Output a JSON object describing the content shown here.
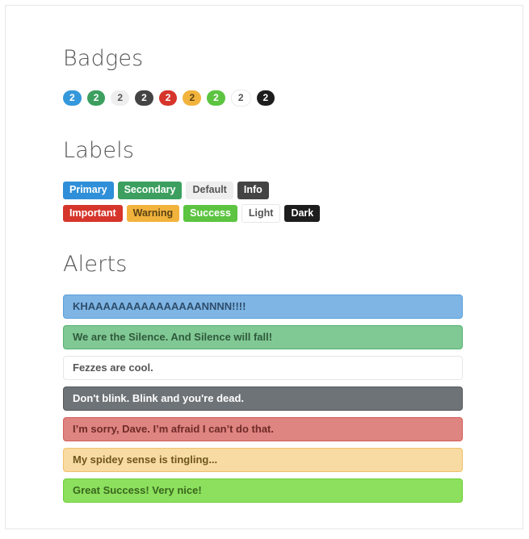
{
  "sections": {
    "badges": {
      "heading": "Badges",
      "items": [
        {
          "name": "primary",
          "text": "2",
          "color": "#3498db"
        },
        {
          "name": "secondary",
          "text": "2",
          "color": "#3c9f5f"
        },
        {
          "name": "default",
          "text": "2",
          "color": "#eeeeee"
        },
        {
          "name": "info",
          "text": "2",
          "color": "#444444"
        },
        {
          "name": "important",
          "text": "2",
          "color": "#d6352b"
        },
        {
          "name": "warning",
          "text": "2",
          "color": "#f2b33d"
        },
        {
          "name": "success",
          "text": "2",
          "color": "#5cc441"
        },
        {
          "name": "light",
          "text": "2",
          "color": "#ffffff"
        },
        {
          "name": "dark",
          "text": "2",
          "color": "#1d1d1d"
        }
      ]
    },
    "labels": {
      "heading": "Labels",
      "row1": [
        {
          "name": "primary",
          "text": "Primary",
          "color": "#2f8fd8"
        },
        {
          "name": "secondary",
          "text": "Secondary",
          "color": "#3c9f5f"
        },
        {
          "name": "default",
          "text": "Default",
          "color": "#eeeeee"
        },
        {
          "name": "info",
          "text": "Info",
          "color": "#444444"
        }
      ],
      "row2": [
        {
          "name": "important",
          "text": "Important",
          "color": "#d6352b"
        },
        {
          "name": "warning",
          "text": "Warning",
          "color": "#f2b33d"
        },
        {
          "name": "success",
          "text": "Success",
          "color": "#5cc441"
        },
        {
          "name": "light",
          "text": "Light",
          "color": "#ffffff"
        },
        {
          "name": "dark",
          "text": "Dark",
          "color": "#1d1d1d"
        }
      ]
    },
    "alerts": {
      "heading": "Alerts",
      "items": [
        {
          "name": "primary",
          "text": "KHAAAAAAAAAAAAAAANNNN!!!!",
          "color": "#7eb5e4"
        },
        {
          "name": "secondary",
          "text": "We are the Silence. And Silence will fall!",
          "color": "#80c894"
        },
        {
          "name": "default",
          "text": "Fezzes are cool.",
          "color": "#ffffff"
        },
        {
          "name": "info",
          "text": "Don't blink. Blink and you're dead.",
          "color": "#6e7377"
        },
        {
          "name": "important",
          "text": "I’m sorry, Dave. I’m afraid I can’t do that.",
          "color": "#de8481"
        },
        {
          "name": "warning",
          "text": "My spidey sense is tingling...",
          "color": "#f8dba2"
        },
        {
          "name": "success",
          "text": "Great Success! Very nice!",
          "color": "#8ce05e"
        }
      ]
    }
  }
}
